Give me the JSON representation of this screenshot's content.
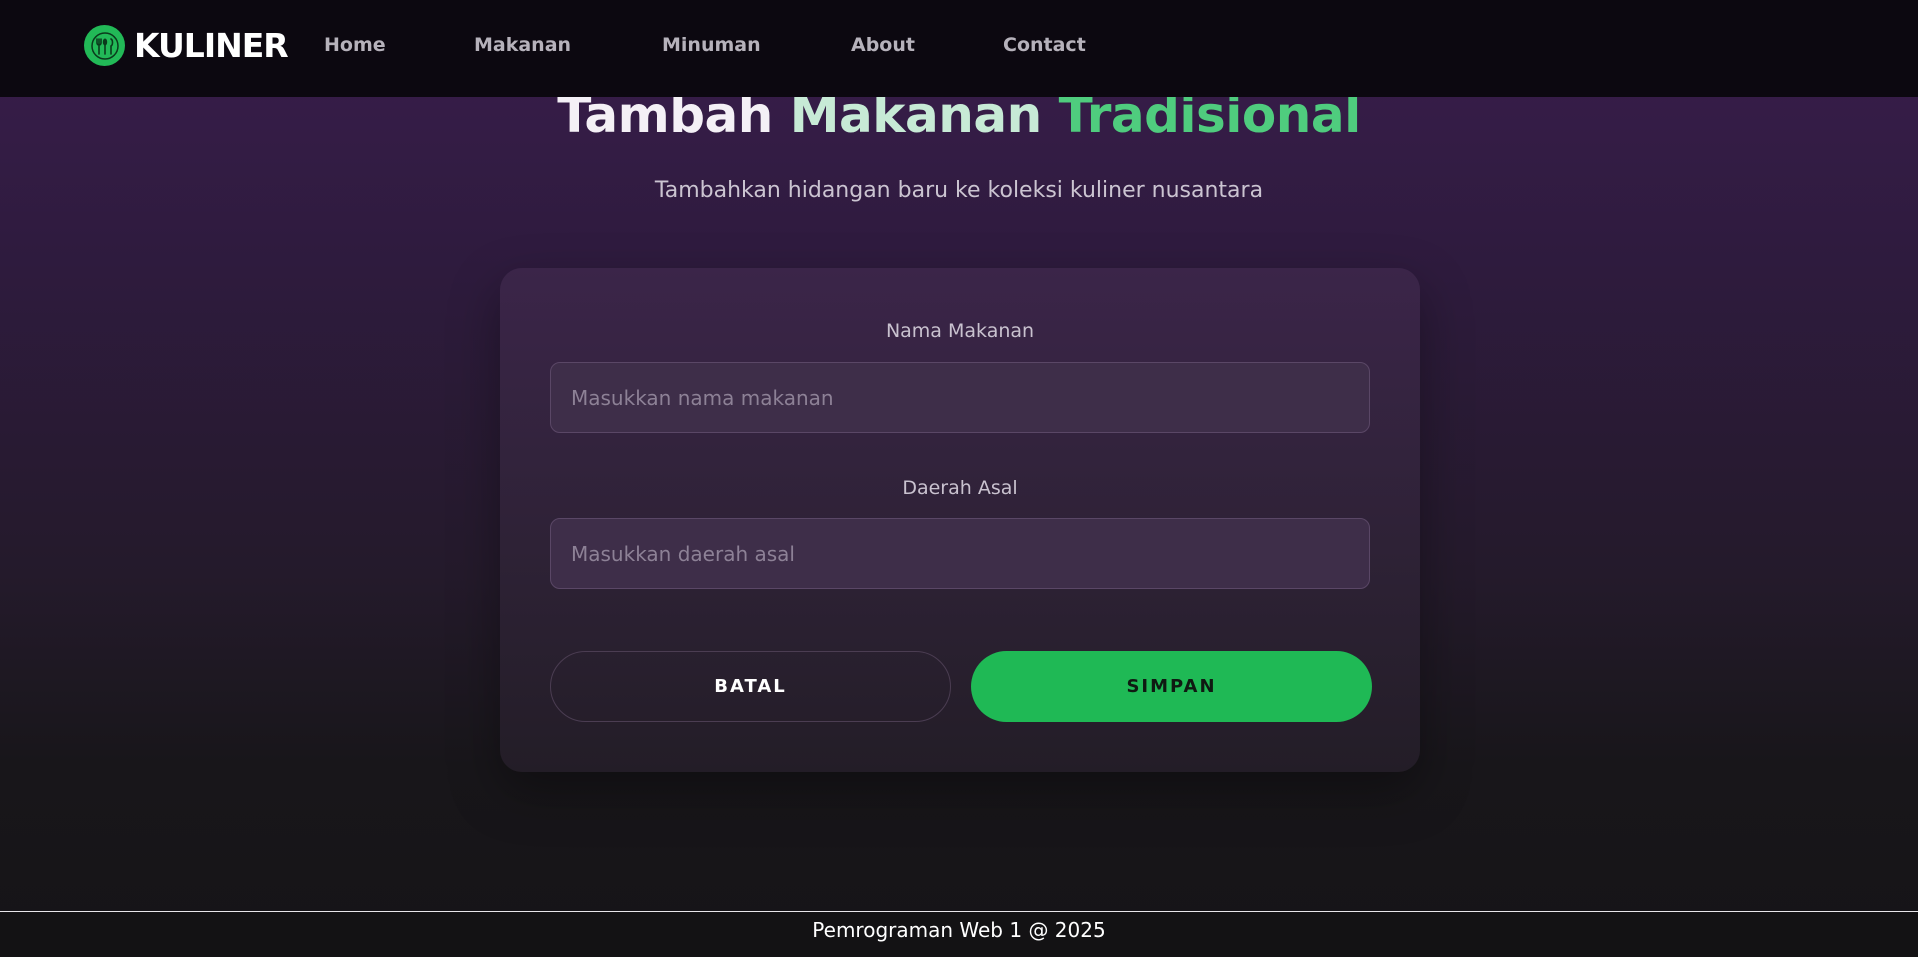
{
  "navbar": {
    "brand": "KULINER",
    "logo_icon": "kuliner-logo-icon",
    "links": [
      "Home",
      "Makanan",
      "Minuman",
      "About",
      "Contact"
    ]
  },
  "hero": {
    "title_part1": "Tambah ",
    "title_part2": "Makanan ",
    "title_part3": "Tradisional",
    "subtitle": "Tambahkan hidangan baru ke koleksi kuliner nusantara"
  },
  "form": {
    "name_label": "Nama Makanan",
    "name_placeholder": "Masukkan nama makanan",
    "name_value": "",
    "region_label": "Daerah Asal",
    "region_placeholder": "Masukkan daerah asal",
    "region_value": "",
    "cancel_label": "BATAL",
    "save_label": "SIMPAN"
  },
  "footer": {
    "text": "Pemrograman Web 1 @ 2025"
  },
  "colors": {
    "accent": "#1fb955",
    "navbar_bg": "#0c0810",
    "title_green": "#4fcc7e"
  }
}
